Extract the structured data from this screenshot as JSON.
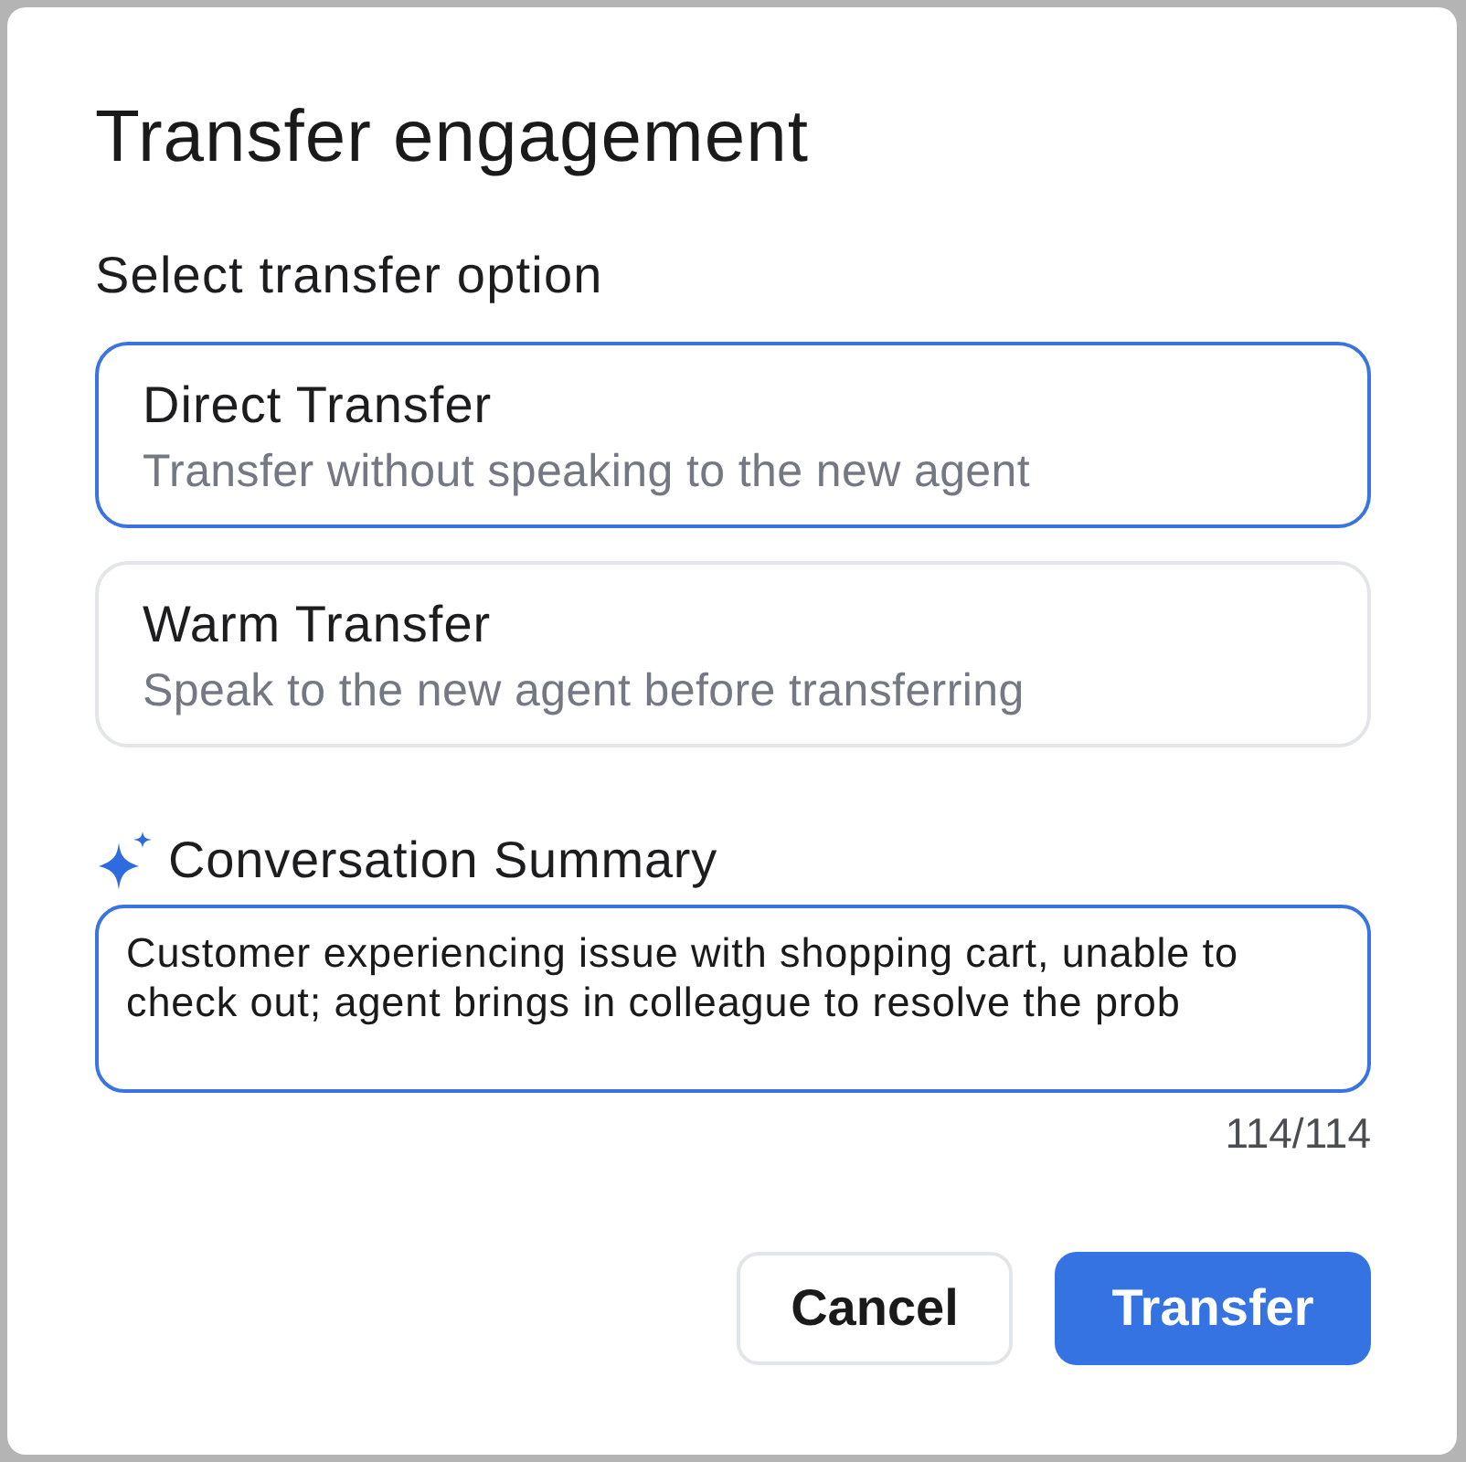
{
  "dialog": {
    "title": "Transfer engagement"
  },
  "transfer_options": {
    "label": "Select transfer option",
    "options": [
      {
        "title": "Direct Transfer",
        "description": "Transfer without speaking to the new agent",
        "selected": true
      },
      {
        "title": "Warm Transfer",
        "description": "Speak to the new agent before transferring",
        "selected": false
      }
    ]
  },
  "summary": {
    "label": "Conversation Summary",
    "value": "Customer experiencing issue with shopping cart, unable to check out; agent brings in colleague to resolve the prob",
    "counter": "114/114"
  },
  "buttons": [
    {
      "label": "Cancel",
      "kind": "secondary"
    },
    {
      "label": "Transfer",
      "kind": "primary"
    }
  ]
}
